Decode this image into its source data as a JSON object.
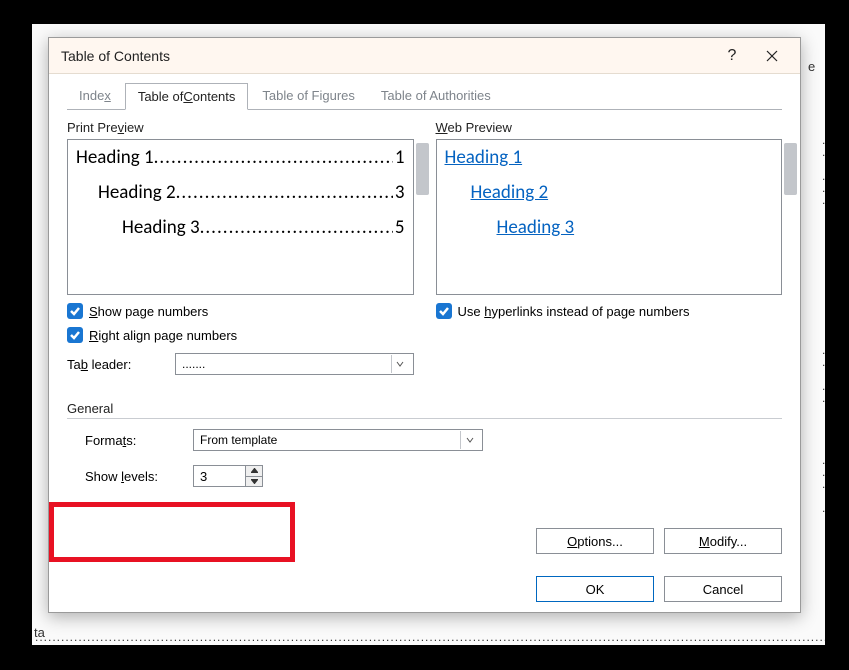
{
  "dialog": {
    "title": "Table of Contents",
    "help_tooltip": "?",
    "close_tooltip": "×"
  },
  "tabs": {
    "index": "Index",
    "toc": "Table of Contents",
    "tof": "Table of Figures",
    "toa": "Table of Authorities"
  },
  "print_preview": {
    "label": "Print Preview",
    "h1": "Heading 1",
    "p1": "1",
    "h2": "Heading 2",
    "p2": "3",
    "h3": "Heading 3",
    "p3": "5"
  },
  "web_preview": {
    "label": "Web Preview",
    "h1": "Heading 1",
    "h2": "Heading 2",
    "h3": "Heading 3"
  },
  "options": {
    "show_page_numbers": "Show page numbers",
    "right_align": "Right align page numbers",
    "use_hyperlinks": "Use hyperlinks instead of page numbers",
    "tab_leader_label": "Tab leader:",
    "tab_leader_value": "......."
  },
  "general": {
    "label": "General",
    "formats_label": "Formats:",
    "formats_value": "From template",
    "show_levels_label": "Show levels:",
    "show_levels_value": "3"
  },
  "buttons": {
    "options": "Options...",
    "modify": "Modify...",
    "ok": "OK",
    "cancel": "Cancel"
  },
  "bg": {
    "e": "e",
    "ta": "ta"
  }
}
